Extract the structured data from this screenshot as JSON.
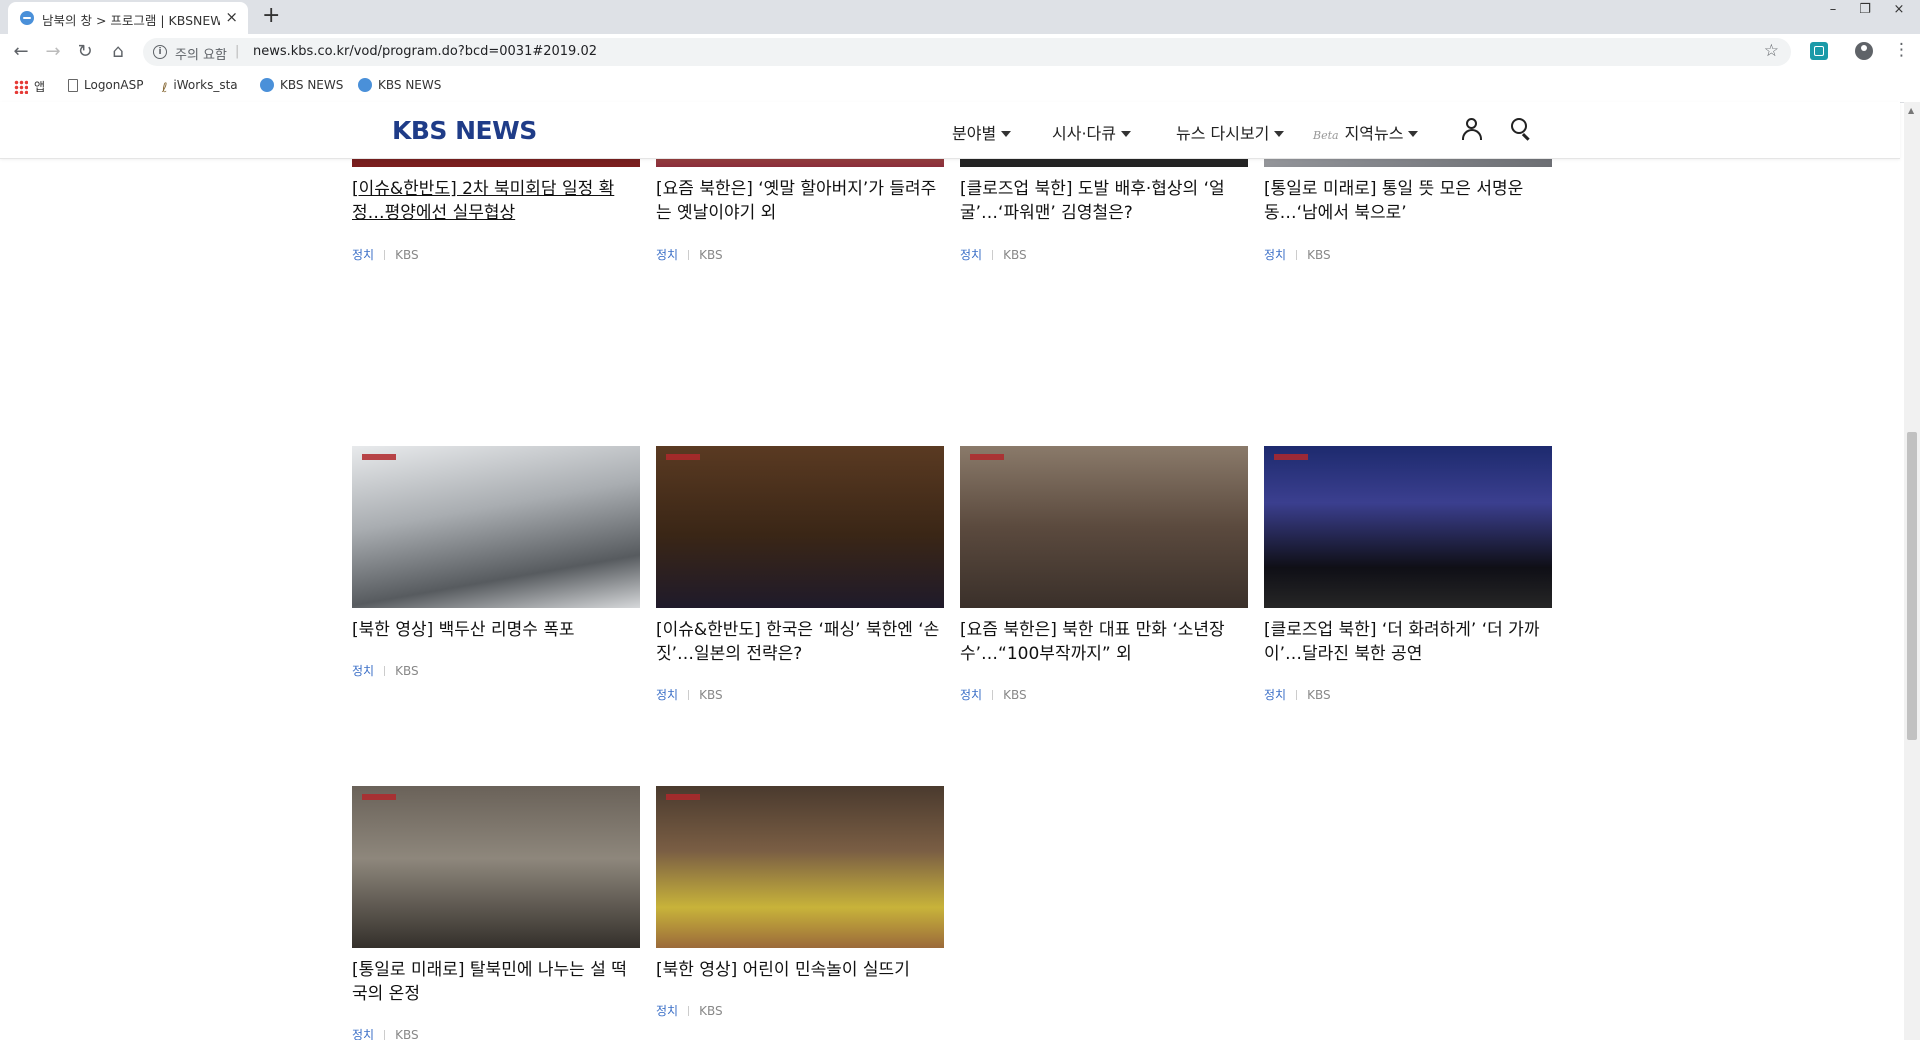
{
  "browser": {
    "tab_title": "남북의 창 > 프로그램 | KBSNEWS",
    "new_tab": "+",
    "close": "×",
    "window_controls": [
      "–",
      "❐",
      "×"
    ],
    "security_label": "주의 요함",
    "url": "news.kbs.co.kr/vod/program.do?bcd=0031#2019.02",
    "bookmarks": [
      "앱",
      "LogonASP",
      "iWorks_sta",
      "KBS NEWS",
      "KBS NEWS"
    ]
  },
  "site": {
    "logo": "KBS NEWS",
    "nav": [
      {
        "label": "분야별"
      },
      {
        "label": "시사·다큐"
      },
      {
        "label": "뉴스 다시보기"
      },
      {
        "label": "지역뉴스",
        "badge": "Beta"
      }
    ]
  },
  "cards": [
    {
      "title": "[이슈&한반도] 2차 북미회담 일정 확정…평양에선 실무협상",
      "category": "정치",
      "source": "KBS"
    },
    {
      "title": "[요즘 북한은] ‘옛말 할아버지’가 들려주는 옛날이야기 외",
      "category": "정치",
      "source": "KBS"
    },
    {
      "title": "[클로즈업 북한] 도발 배후·협상의 ‘얼굴’…‘파워맨’ 김영철은?",
      "category": "정치",
      "source": "KBS"
    },
    {
      "title": "[통일로 미래로] 통일 뜻 모은 서명운동…‘남에서 북으로’",
      "category": "정치",
      "source": "KBS"
    },
    {
      "title": "[북한 영상] 백두산 리명수 폭포",
      "category": "정치",
      "source": "KBS"
    },
    {
      "title": "[이슈&한반도] 한국은 ‘패싱’ 북한엔 ‘손짓’…일본의 전략은?",
      "category": "정치",
      "source": "KBS"
    },
    {
      "title": "[요즘 북한은] 북한 대표 만화 ‘소년장수’…“100부작까지” 외",
      "category": "정치",
      "source": "KBS"
    },
    {
      "title": "[클로즈업 북한] ‘더 화려하게’ ‘더 가까이’…달라진 북한 공연",
      "category": "정치",
      "source": "KBS"
    },
    {
      "title": "[통일로 미래로] 탈북민에 나누는 설 떡국의 온정",
      "category": "정치",
      "source": "KBS"
    },
    {
      "title": "[북한 영상] 어린이 민속놀이 실뜨기",
      "category": "정치",
      "source": "KBS"
    }
  ]
}
